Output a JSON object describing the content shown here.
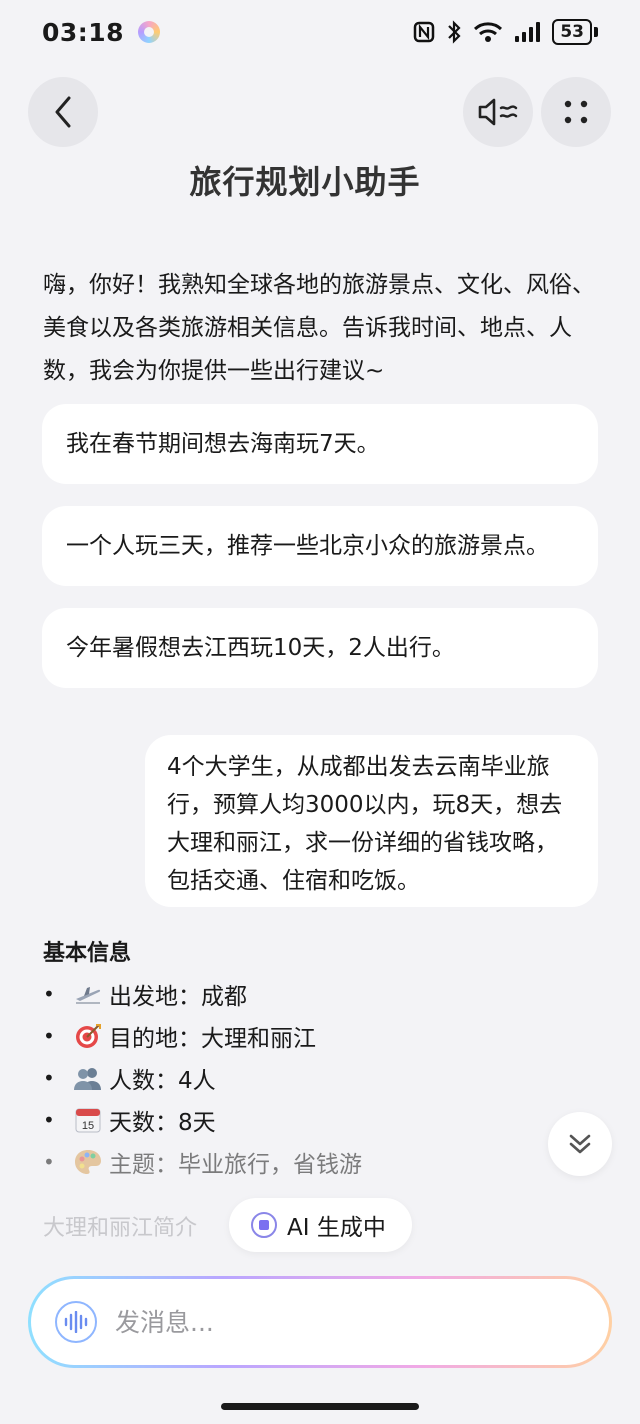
{
  "status_bar": {
    "time": "03:18",
    "battery": "53"
  },
  "header": {
    "title": "旅行规划小助手",
    "back_icon": "chevron-left-icon",
    "speaker_icon": "speaker-icon",
    "more_icon": "grid-dots-icon"
  },
  "chat": {
    "intro": "嗨，你好！我熟知全球各地的旅游景点、文化、风俗、美食以及各类旅游相关信息。告诉我时间、地点、人数，我会为你提供一些出行建议~",
    "suggestions": [
      "我在春节期间想去海南玩7天。",
      "一个人玩三天，推荐一些北京小众的旅游景点。",
      "今年暑假想去江西玩10天，2人出行。"
    ],
    "user_message": "4个大学生，从成都出发去云南毕业旅行，预算人均3000以内，玩8天，想去大理和丽江，求一份详细的省钱攻略，包括交通、住宿和吃饭。",
    "reply": {
      "section_title": "基本信息",
      "items": [
        {
          "bullet": "•",
          "icon": "airplane-icon",
          "text": "出发地：成都"
        },
        {
          "bullet": "•",
          "icon": "target-icon",
          "text": "目的地：大理和丽江"
        },
        {
          "bullet": "•",
          "icon": "people-icon",
          "text": "人数：4人"
        },
        {
          "bullet": "•",
          "icon": "calendar-icon",
          "calendar_day": "15",
          "text": "天数：8天"
        },
        {
          "bullet": "•",
          "icon": "palette-icon",
          "text": "主题：毕业旅行，省钱游"
        }
      ],
      "faded_text": "大理和丽江简介"
    }
  },
  "generating": {
    "label": "AI 生成中"
  },
  "composer": {
    "placeholder": "发消息..."
  },
  "colors": {
    "background": "#f3f3f6",
    "bubble": "#ffffff",
    "accent": "#7b6ff0"
  }
}
